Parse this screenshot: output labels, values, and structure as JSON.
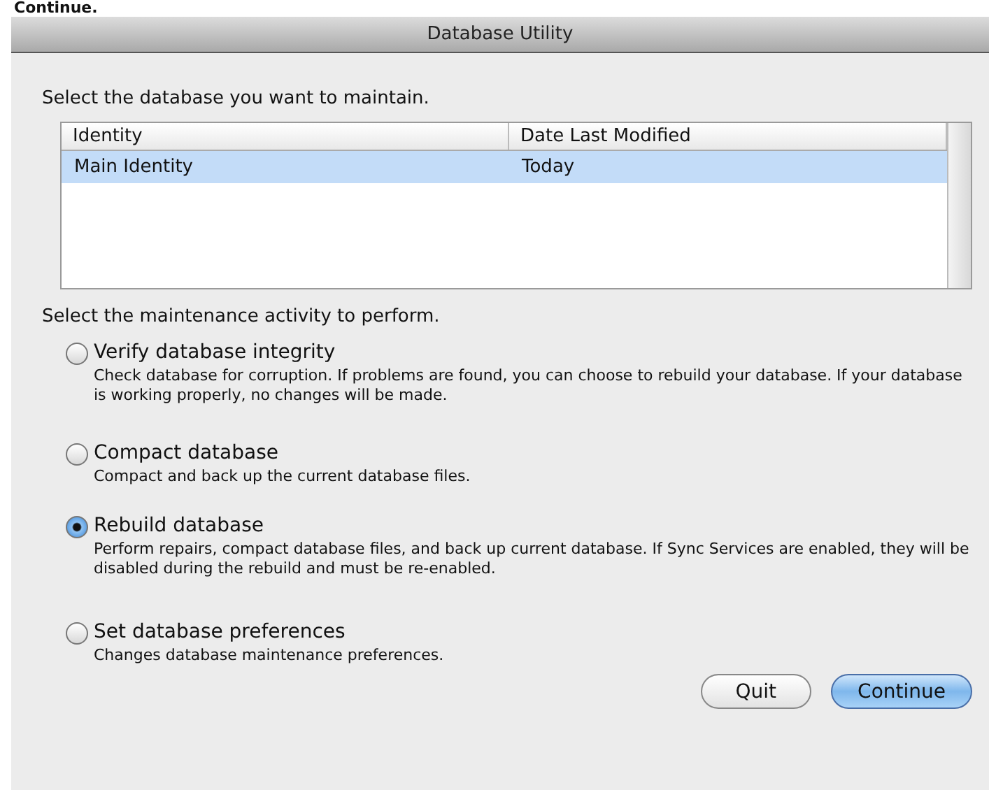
{
  "page_heading": "Continue.",
  "window": {
    "title": "Database Utility"
  },
  "database_prompt": "Select the database you want to maintain.",
  "table": {
    "columns": [
      "Identity",
      "Date Last Modified"
    ],
    "rows": [
      {
        "cells": [
          "Main Identity",
          "Today"
        ],
        "selected": true
      }
    ]
  },
  "activity_prompt": "Select the maintenance activity to perform.",
  "options": [
    {
      "label": "Verify database integrity",
      "description": "Check database for corruption. If problems are found, you can choose to rebuild your database. If your database is working properly, no changes will be made.",
      "selected": false
    },
    {
      "label": "Compact database",
      "description": "Compact and back up the current database files.",
      "selected": false
    },
    {
      "label": "Rebuild database",
      "description": "Perform repairs, compact database files, and back up current database. If Sync Services are enabled, they will be disabled during the rebuild and must be re-enabled.",
      "selected": true
    },
    {
      "label": "Set database preferences",
      "description": "Changes database maintenance preferences.",
      "selected": false
    }
  ],
  "buttons": [
    {
      "label": "Quit",
      "default": false
    },
    {
      "label": "Continue",
      "default": true
    }
  ]
}
